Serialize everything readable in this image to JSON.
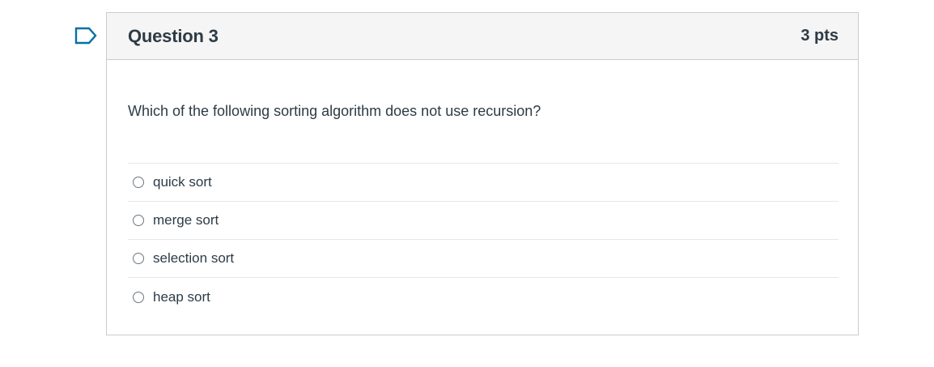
{
  "icons": {
    "flag": "flag-outline-icon",
    "radio": "radio-unchecked-icon"
  },
  "colors": {
    "flag_stroke": "#0770a3",
    "text": "#2d3b45",
    "header_bg": "#f5f5f5",
    "border": "#c7cdd1"
  },
  "question": {
    "title": "Question 3",
    "points": "3 pts",
    "text": "Which of the following sorting algorithm does not use recursion?",
    "answers": [
      {
        "label": "quick sort",
        "selected": false
      },
      {
        "label": "merge sort",
        "selected": false
      },
      {
        "label": "selection sort",
        "selected": false
      },
      {
        "label": "heap sort",
        "selected": false
      }
    ]
  }
}
